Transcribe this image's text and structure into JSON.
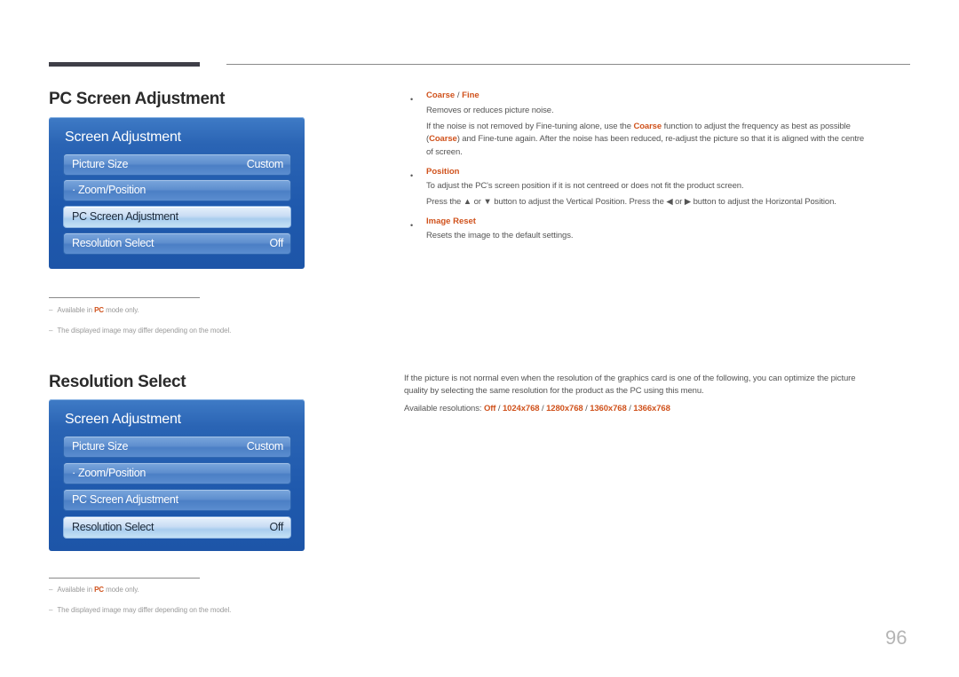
{
  "page_number": "96",
  "colors": {
    "accent": "#d0521c",
    "osd_blue": "#1f59ad",
    "osd_selected": "#c9ddf4"
  },
  "sections": [
    {
      "title": "PC Screen Adjustment",
      "osd": {
        "title": "Screen Adjustment",
        "items": [
          {
            "label": "Picture Size",
            "value": "Custom",
            "selected": false
          },
          {
            "label": "· Zoom/Position",
            "value": "",
            "selected": false
          },
          {
            "label": "PC Screen Adjustment",
            "value": "",
            "selected": true
          },
          {
            "label": "Resolution Select",
            "value": "Off",
            "selected": false
          }
        ]
      },
      "notes": [
        {
          "dash": "–",
          "pre": "Available in ",
          "accent": "PC",
          "post": " mode only."
        },
        {
          "dash": "–",
          "text": "The displayed image may differ depending on the model."
        }
      ]
    },
    {
      "title": "Resolution Select",
      "osd": {
        "title": "Screen Adjustment",
        "items": [
          {
            "label": "Picture Size",
            "value": "Custom",
            "selected": false
          },
          {
            "label": "· Zoom/Position",
            "value": "",
            "selected": false
          },
          {
            "label": "PC Screen Adjustment",
            "value": "",
            "selected": false
          },
          {
            "label": "Resolution Select",
            "value": "Off",
            "selected": true
          }
        ]
      },
      "notes": [
        {
          "dash": "–",
          "pre": "Available in ",
          "accent": "PC",
          "post": " mode only."
        },
        {
          "dash": "–",
          "text": "The displayed image may differ depending on the model."
        }
      ]
    }
  ],
  "pc_adjust_text": {
    "bullets": [
      {
        "dot": "•",
        "head_a": "Coarse",
        "head_sep": " / ",
        "head_b": "Fine",
        "lines": {
          "l1": "Removes or reduces picture noise.",
          "l2_pre": "If the noise is not removed by Fine-tuning alone, use the ",
          "l2_accent": "Coarse",
          "l2_post": " function to adjust the frequency as best as possible",
          "l3_pre": "(",
          "l3_accent": "Coarse",
          "l3_post": ") and Fine-tune again. After the noise has been reduced, re-adjust the picture so that it is aligned with the centre",
          "l4": "of screen."
        }
      },
      {
        "dot": "•",
        "head": "Position",
        "lines": {
          "l1": "To adjust the PC's screen position if it is not centreed or does not fit the product screen.",
          "l2": "Press the ▲ or ▼ button to adjust the Vertical Position. Press the ◀ or ▶ button to adjust the Horizontal Position."
        }
      },
      {
        "dot": "•",
        "head": "Image Reset",
        "lines": {
          "l1": "Resets the image to the default settings."
        }
      }
    ]
  },
  "resolution_text": {
    "p1_l1": "If the picture is not normal even when the resolution of the graphics card is one of the following, you can optimize the picture",
    "p1_l2": "quality by selecting the same resolution for the product as the PC using this menu.",
    "available_label": "Available resolutions: ",
    "options": [
      "Off",
      "1024x768",
      "1280x768",
      "1360x768",
      "1366x768"
    ],
    "sep": " / "
  }
}
